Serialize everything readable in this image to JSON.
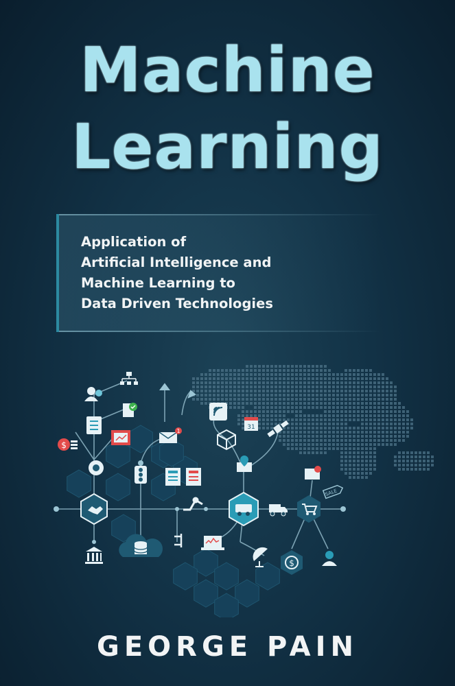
{
  "cover": {
    "title_line1": "Machine",
    "title_line2": "Learning",
    "subtitle_lines": [
      "Application of",
      "Artificial Intelligence and",
      "Machine Learning to",
      "Data Driven Technologies"
    ],
    "author": "GEORGE PAIN"
  },
  "illustration": {
    "calendar_day": "31",
    "tag_text": "SALE",
    "currency_symbol": "$",
    "notification_count": "1",
    "icons": [
      "world-map-dots",
      "users-icon",
      "org-chart-icon",
      "checklist-icon",
      "coins-icon",
      "presentation-icon",
      "handshake-icon",
      "envelope-icon",
      "traffic-light-icon",
      "document-icon",
      "wifi-tablet-icon",
      "package-box-icon",
      "calendar-icon",
      "satellite-icon",
      "map-pin-icon",
      "truck-icon",
      "shopping-cart-icon",
      "price-tag-icon",
      "bank-icon",
      "database-icon",
      "laptop-chart-icon",
      "satellite-dish-icon",
      "dollar-coin-icon",
      "person-icon",
      "gear-arm-icon"
    ]
  },
  "colors": {
    "background": "#123246",
    "title": "#a9e2ee",
    "accent": "#2c8aa1",
    "hexagon": "#1d5066",
    "text_light": "#f1f4f5"
  }
}
